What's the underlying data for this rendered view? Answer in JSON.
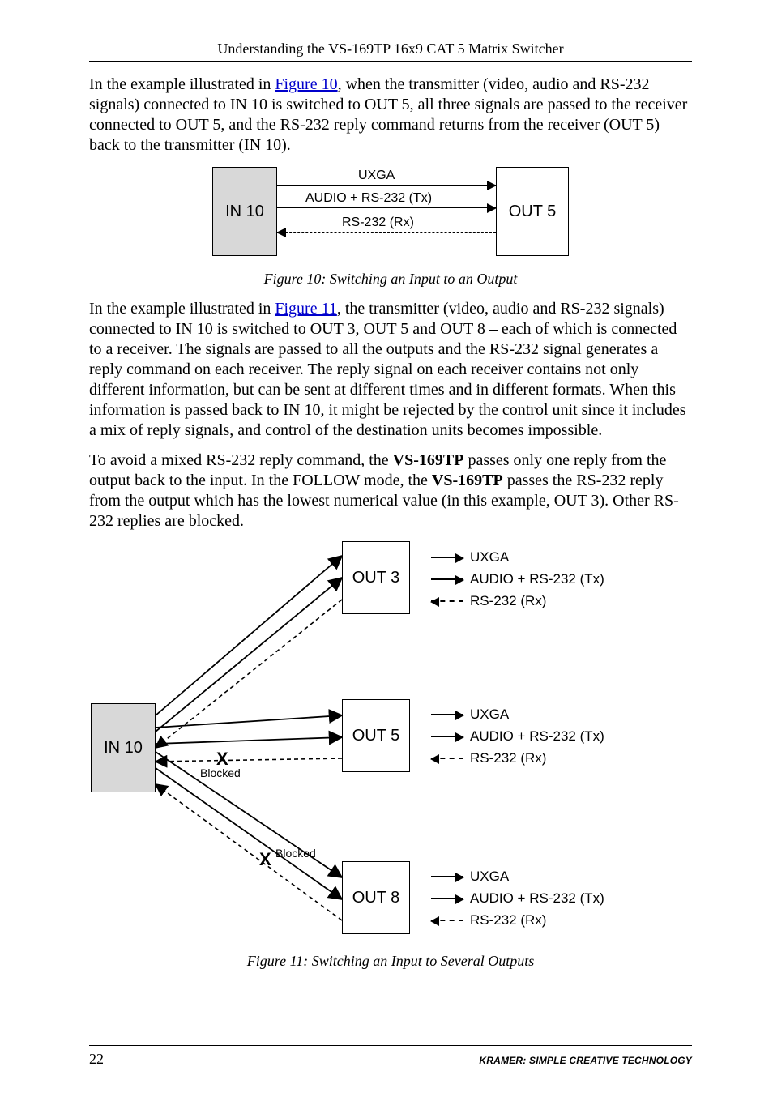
{
  "header": {
    "running_title": "Understanding the VS-169TP 16x9 CAT 5 Matrix Switcher"
  },
  "para1": {
    "pre": "In the example illustrated in ",
    "link": "Figure 10",
    "post": ", when the transmitter (video, audio and RS-232 signals) connected to IN 10 is switched to OUT 5, all three signals are passed to the receiver connected to OUT 5, and the RS-232 reply command returns from the receiver (OUT 5) back to the transmitter (IN 10)."
  },
  "fig10": {
    "in_label": "IN 10",
    "out_label": "OUT 5",
    "sig1": "UXGA",
    "sig2": "AUDIO + RS-232 (Tx)",
    "sig3": "RS-232 (Rx)",
    "caption": "Figure 10: Switching an Input to an Output"
  },
  "para2": {
    "pre": "In the example illustrated in ",
    "link": "Figure 11",
    "post": ", the transmitter (video, audio and RS-232 signals) connected to IN 10 is switched to OUT 3, OUT 5 and OUT 8 – each of which is connected to a receiver. The signals are passed to all the outputs and the RS-232 signal generates a reply command on each receiver. The reply signal on each receiver contains not only different information, but can be sent at different times and in different formats. When this information is passed back to IN 10, it might be rejected by the control unit since it includes a mix of reply signals, and control of the destination units becomes impossible."
  },
  "para3": {
    "t1": "To avoid a mixed RS-232 reply command, the ",
    "b1": "VS-169TP",
    "t2": " passes only one reply from the output back to the input. In the FOLLOW mode, the ",
    "b2": "VS-169TP",
    "t3": " passes the RS-232 reply from the output which has the lowest numerical value (in this example, OUT 3). Other RS-232 replies are blocked."
  },
  "fig11": {
    "in_label": "IN 10",
    "out3": "OUT 3",
    "out5": "OUT 5",
    "out8": "OUT 8",
    "leg_uxga": "UXGA",
    "leg_audio": "AUDIO + RS-232 (Tx)",
    "leg_rx": "RS-232 (Rx)",
    "blocked": "Blocked",
    "x": "X",
    "caption": "Figure 11: Switching an Input to Several Outputs"
  },
  "footer": {
    "page": "22",
    "tagline": "KRAMER:  SIMPLE CREATIVE TECHNOLOGY"
  }
}
